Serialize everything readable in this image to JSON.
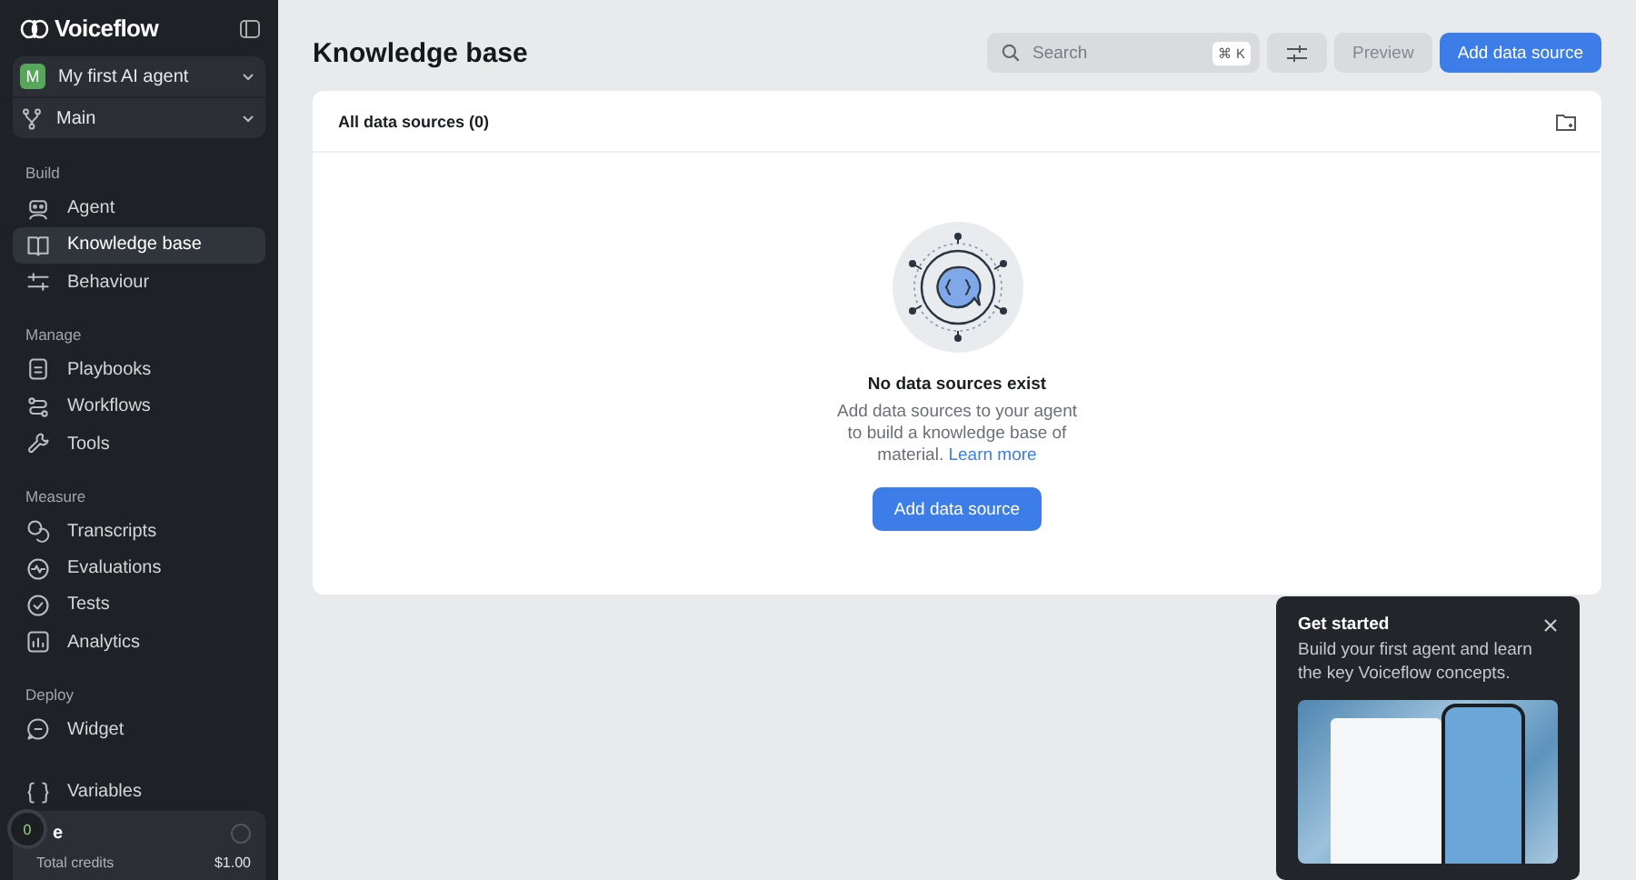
{
  "sidebar": {
    "logo": "Voiceflow",
    "agent": {
      "initial": "M",
      "name": "My first AI agent"
    },
    "branch": "Main",
    "sections": [
      {
        "heading": "Build",
        "items": [
          {
            "label": "Agent",
            "selected": false
          },
          {
            "label": "Knowledge base",
            "selected": true
          },
          {
            "label": "Behaviour",
            "selected": false
          }
        ]
      },
      {
        "heading": "Manage",
        "items": [
          {
            "label": "Playbooks",
            "selected": false
          },
          {
            "label": "Workflows",
            "selected": false
          },
          {
            "label": "Tools",
            "selected": false
          }
        ]
      },
      {
        "heading": "Measure",
        "items": [
          {
            "label": "Transcripts",
            "selected": false
          },
          {
            "label": "Evaluations",
            "selected": false
          },
          {
            "label": "Tests",
            "selected": false
          },
          {
            "label": "Analytics",
            "selected": false
          }
        ]
      },
      {
        "heading": "Deploy",
        "items": [
          {
            "label": "Widget",
            "selected": false
          }
        ]
      }
    ],
    "variables": {
      "label": "Variables",
      "selected": false
    },
    "credits": {
      "badge": "0",
      "title": "e",
      "rows": [
        {
          "label": "Total credits",
          "value": "$1.00"
        }
      ]
    }
  },
  "page_title": "Knowledge base",
  "toolbar": {
    "search": {
      "placeholder": "Search",
      "shortcut": "⌘ K"
    },
    "preview": "Preview",
    "add_button": "Add data source"
  },
  "panel": {
    "title": "All data sources (0)",
    "empty": {
      "title": "No data sources exist",
      "text": "Add data sources to your agent to build a knowledge base of material.",
      "link": "Learn more",
      "button": "Add data source"
    }
  },
  "get_started": {
    "title": "Get started",
    "text": "Build your first agent and learn the key Voiceflow concepts."
  }
}
